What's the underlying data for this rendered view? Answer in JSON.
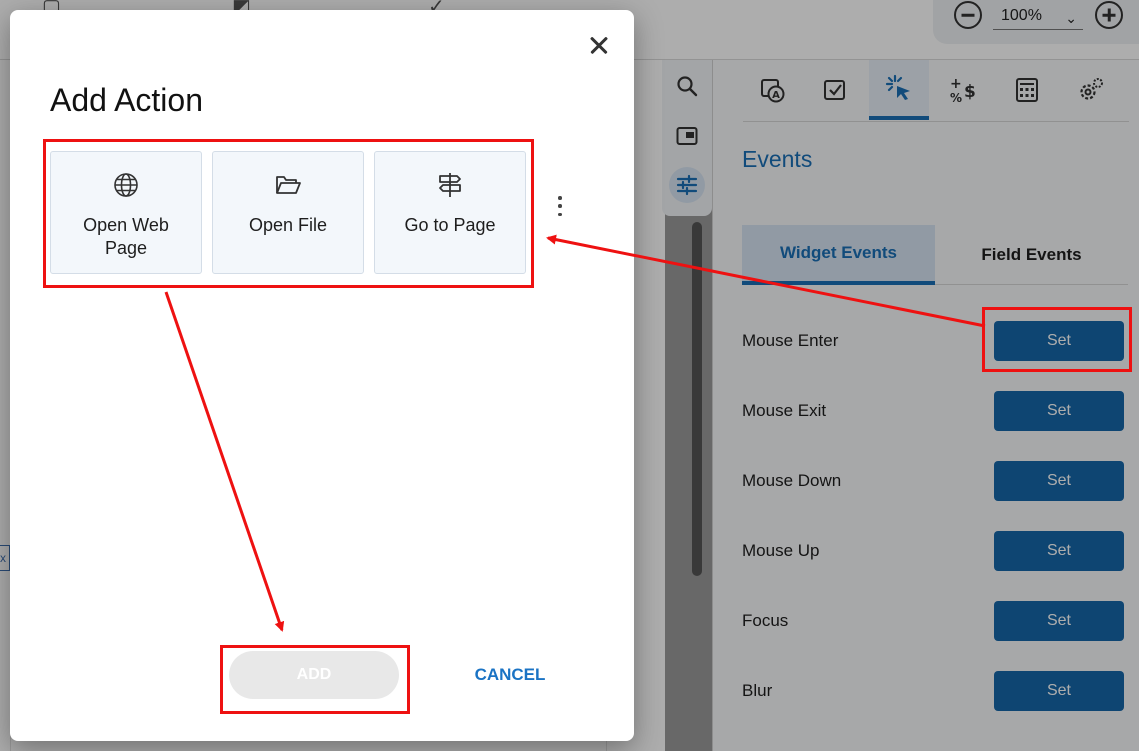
{
  "zoom": {
    "value": "100%"
  },
  "background_stub": "x",
  "panel": {
    "title": "Events",
    "tabs": [
      {
        "icon": "text-field-icon"
      },
      {
        "icon": "checkbox-icon"
      },
      {
        "icon": "click-events-icon",
        "active": true
      },
      {
        "icon": "calculation-icon"
      },
      {
        "icon": "calculator-icon"
      },
      {
        "icon": "settings-gear-icon"
      }
    ],
    "event_tabs": {
      "widget": "Widget Events",
      "field": "Field Events"
    },
    "events": [
      {
        "label": "Mouse Enter",
        "button": "Set"
      },
      {
        "label": "Mouse Exit",
        "button": "Set"
      },
      {
        "label": "Mouse Down",
        "button": "Set"
      },
      {
        "label": "Mouse Up",
        "button": "Set"
      },
      {
        "label": "Focus",
        "button": "Set"
      },
      {
        "label": "Blur",
        "button": "Set"
      }
    ]
  },
  "dialog": {
    "title": "Add Action",
    "actions": [
      {
        "label": "Open Web Page",
        "icon": "globe-icon"
      },
      {
        "label": "Open File",
        "icon": "folder-open-icon"
      },
      {
        "label": "Go to Page",
        "icon": "signpost-icon"
      }
    ],
    "add_label": "ADD",
    "cancel_label": "CANCEL"
  },
  "colors": {
    "accent": "#1a6fb5",
    "set_button": "#1666a8",
    "annotation": "#ee1111",
    "cancel_text": "#1a73c4"
  }
}
